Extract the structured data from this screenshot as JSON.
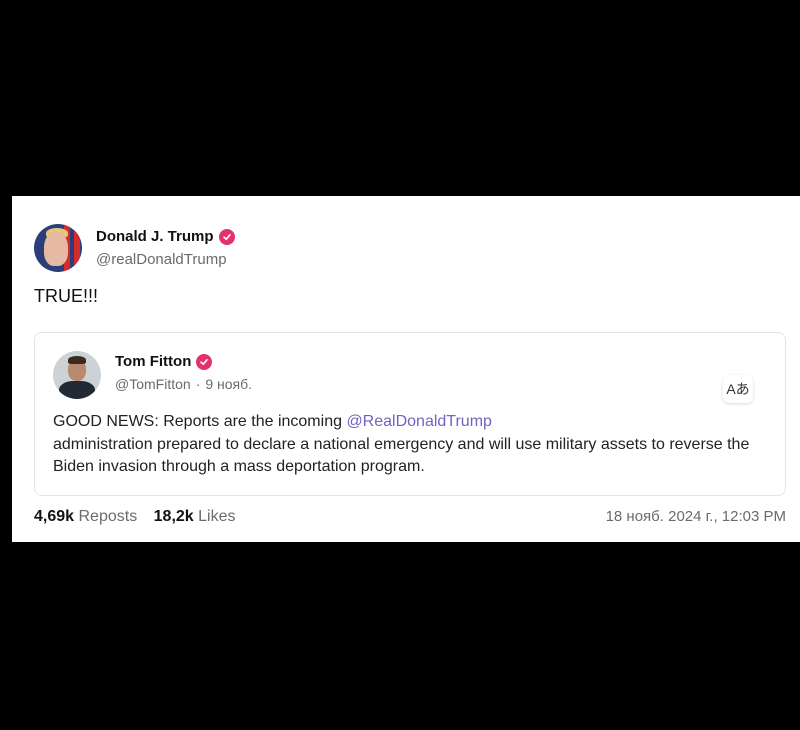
{
  "post": {
    "author": {
      "name": "Donald J. Trump",
      "handle": "@realDonaldTrump"
    },
    "text": "TRUE!!!",
    "quote": {
      "author": {
        "name": "Tom Fitton",
        "handle": "@TomFitton",
        "date": "9 нояб."
      },
      "body_prefix": "GOOD NEWS: Reports are the incoming",
      "mention": "@RealDonaldTrump",
      "body_suffix": " administration prepared to declare a national emergency and will use military assets to reverse the Biden invasion through a mass deportation program.",
      "translate_glyph": "Aあ"
    },
    "stats": {
      "reposts_count": "4,69k",
      "reposts_label": "Reposts",
      "likes_count": "18,2k",
      "likes_label": "Likes"
    },
    "timestamp": "18 нояб. 2024 г., 12:03 PM"
  },
  "colors": {
    "verified": "#e2336e",
    "mention": "#6e64c4",
    "background": "#000000"
  },
  "icons": {
    "verified": "verified-badge-icon",
    "translate": "translate-icon"
  }
}
